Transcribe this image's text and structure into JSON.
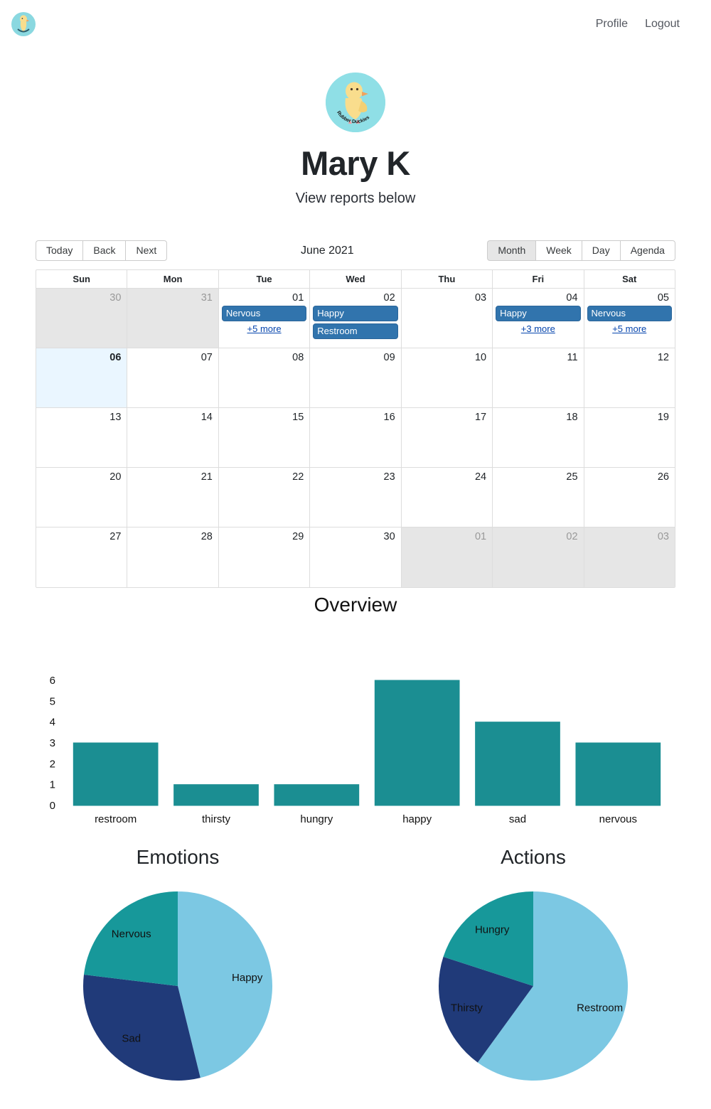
{
  "nav": {
    "logo_icon": "rubber-duck-logo-icon",
    "links": [
      {
        "label": "Profile"
      },
      {
        "label": "Logout"
      }
    ]
  },
  "profile": {
    "badge_icon": "rubber-duck-badge-icon",
    "badge_text": "Rubber Duckies",
    "name": "Mary K",
    "subtitle": "View reports below"
  },
  "calendar": {
    "nav_buttons": [
      {
        "label": "Today",
        "active": false
      },
      {
        "label": "Back",
        "active": false
      },
      {
        "label": "Next",
        "active": false
      }
    ],
    "title": "June 2021",
    "view_buttons": [
      {
        "label": "Month",
        "active": true
      },
      {
        "label": "Week",
        "active": false
      },
      {
        "label": "Day",
        "active": false
      },
      {
        "label": "Agenda",
        "active": false
      }
    ],
    "weekdays": [
      "Sun",
      "Mon",
      "Tue",
      "Wed",
      "Thu",
      "Fri",
      "Sat"
    ],
    "weeks": [
      [
        {
          "day": "30",
          "off": true,
          "today": false,
          "events": [],
          "more": ""
        },
        {
          "day": "31",
          "off": true,
          "today": false,
          "events": [],
          "more": ""
        },
        {
          "day": "01",
          "off": false,
          "today": false,
          "events": [
            "Nervous"
          ],
          "more": "+5 more"
        },
        {
          "day": "02",
          "off": false,
          "today": false,
          "events": [
            "Happy",
            "Restroom"
          ],
          "more": ""
        },
        {
          "day": "03",
          "off": false,
          "today": false,
          "events": [],
          "more": ""
        },
        {
          "day": "04",
          "off": false,
          "today": false,
          "events": [
            "Happy"
          ],
          "more": "+3 more"
        },
        {
          "day": "05",
          "off": false,
          "today": false,
          "events": [
            "Nervous"
          ],
          "more": "+5 more"
        }
      ],
      [
        {
          "day": "06",
          "off": false,
          "today": true,
          "events": [],
          "more": ""
        },
        {
          "day": "07",
          "off": false,
          "today": false,
          "events": [],
          "more": ""
        },
        {
          "day": "08",
          "off": false,
          "today": false,
          "events": [],
          "more": ""
        },
        {
          "day": "09",
          "off": false,
          "today": false,
          "events": [],
          "more": ""
        },
        {
          "day": "10",
          "off": false,
          "today": false,
          "events": [],
          "more": ""
        },
        {
          "day": "11",
          "off": false,
          "today": false,
          "events": [],
          "more": ""
        },
        {
          "day": "12",
          "off": false,
          "today": false,
          "events": [],
          "more": ""
        }
      ],
      [
        {
          "day": "13",
          "off": false,
          "today": false,
          "events": [],
          "more": ""
        },
        {
          "day": "14",
          "off": false,
          "today": false,
          "events": [],
          "more": ""
        },
        {
          "day": "15",
          "off": false,
          "today": false,
          "events": [],
          "more": ""
        },
        {
          "day": "16",
          "off": false,
          "today": false,
          "events": [],
          "more": ""
        },
        {
          "day": "17",
          "off": false,
          "today": false,
          "events": [],
          "more": ""
        },
        {
          "day": "18",
          "off": false,
          "today": false,
          "events": [],
          "more": ""
        },
        {
          "day": "19",
          "off": false,
          "today": false,
          "events": [],
          "more": ""
        }
      ],
      [
        {
          "day": "20",
          "off": false,
          "today": false,
          "events": [],
          "more": ""
        },
        {
          "day": "21",
          "off": false,
          "today": false,
          "events": [],
          "more": ""
        },
        {
          "day": "22",
          "off": false,
          "today": false,
          "events": [],
          "more": ""
        },
        {
          "day": "23",
          "off": false,
          "today": false,
          "events": [],
          "more": ""
        },
        {
          "day": "24",
          "off": false,
          "today": false,
          "events": [],
          "more": ""
        },
        {
          "day": "25",
          "off": false,
          "today": false,
          "events": [],
          "more": ""
        },
        {
          "day": "26",
          "off": false,
          "today": false,
          "events": [],
          "more": ""
        }
      ],
      [
        {
          "day": "27",
          "off": false,
          "today": false,
          "events": [],
          "more": ""
        },
        {
          "day": "28",
          "off": false,
          "today": false,
          "events": [],
          "more": ""
        },
        {
          "day": "29",
          "off": false,
          "today": false,
          "events": [],
          "more": ""
        },
        {
          "day": "30",
          "off": false,
          "today": false,
          "events": [],
          "more": ""
        },
        {
          "day": "01",
          "off": true,
          "today": false,
          "events": [],
          "more": ""
        },
        {
          "day": "02",
          "off": true,
          "today": false,
          "events": [],
          "more": ""
        },
        {
          "day": "03",
          "off": true,
          "today": false,
          "events": [],
          "more": ""
        }
      ]
    ]
  },
  "overview_title": "Overview",
  "pie_section_titles": {
    "left": "Emotions",
    "right": "Actions"
  },
  "colors": {
    "teal": "#1b8e92",
    "pie_teal": "#17989a",
    "pie_light_blue": "#7cc8e3",
    "pie_navy": "#203a79",
    "event_blue": "#3174ad",
    "today_bg": "#eaf6ff",
    "offrange_bg": "#e6e6e6",
    "duck_badge_bg": "#8fdfe6",
    "duck_body": "#f9dd8d"
  },
  "chart_data": [
    {
      "type": "bar",
      "title": "Overview",
      "categories": [
        "restroom",
        "thirsty",
        "hungry",
        "happy",
        "sad",
        "nervous"
      ],
      "values": [
        3,
        1,
        1,
        6,
        4,
        3
      ],
      "xlabel": "",
      "ylabel": "",
      "ylim": [
        0,
        6
      ],
      "yticks": [
        0,
        1,
        2,
        3,
        4,
        5,
        6
      ],
      "grid": false,
      "legend": "none",
      "color": "#1b8e92"
    },
    {
      "type": "pie",
      "title": "Emotions",
      "labels": [
        "Happy",
        "Sad",
        "Nervous"
      ],
      "values": [
        6,
        4,
        3
      ],
      "colors": [
        "#7cc8e3",
        "#203a79",
        "#17989a"
      ],
      "legend": "labels-on-slices",
      "start_angle_deg": 0
    },
    {
      "type": "pie",
      "title": "Actions",
      "labels": [
        "Restroom",
        "Thirsty",
        "Hungry"
      ],
      "values": [
        3,
        1,
        1
      ],
      "colors": [
        "#7cc8e3",
        "#203a79",
        "#17989a"
      ],
      "legend": "labels-on-slices",
      "start_angle_deg": 0
    }
  ]
}
